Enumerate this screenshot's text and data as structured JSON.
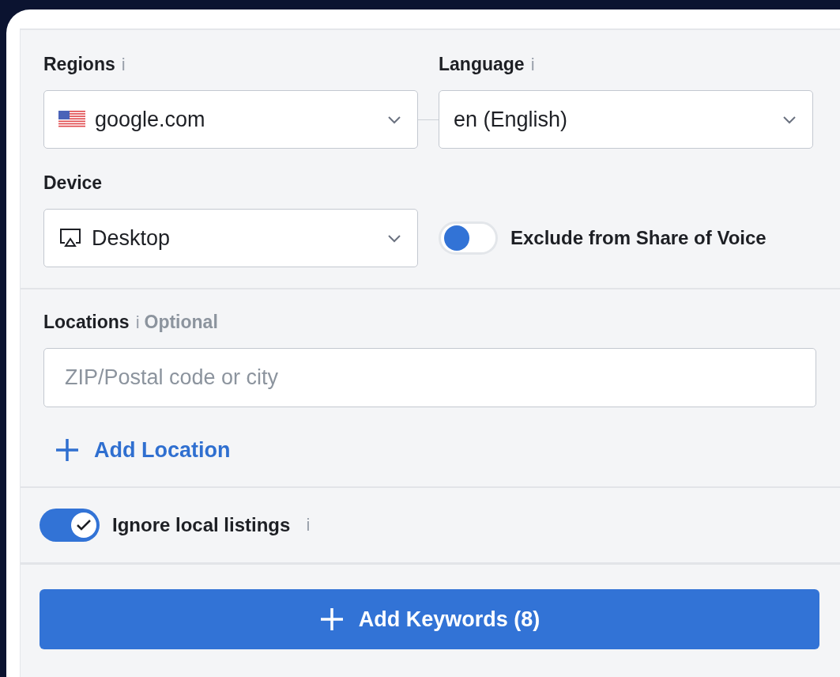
{
  "regions": {
    "label": "Regions",
    "info": "i",
    "value": "google.com"
  },
  "language": {
    "label": "Language",
    "info": "i",
    "value": "en (English)"
  },
  "device": {
    "label": "Device",
    "value": "Desktop"
  },
  "exclude_toggle": {
    "label": "Exclude from Share of Voice",
    "on": false
  },
  "locations": {
    "label": "Locations",
    "info": "i",
    "optional": "Optional",
    "placeholder": "ZIP/Postal code or city"
  },
  "add_location": "Add Location",
  "ignore_toggle": {
    "label": "Ignore local listings",
    "info": "i",
    "on": true
  },
  "add_keywords_button": "Add Keywords (8)"
}
